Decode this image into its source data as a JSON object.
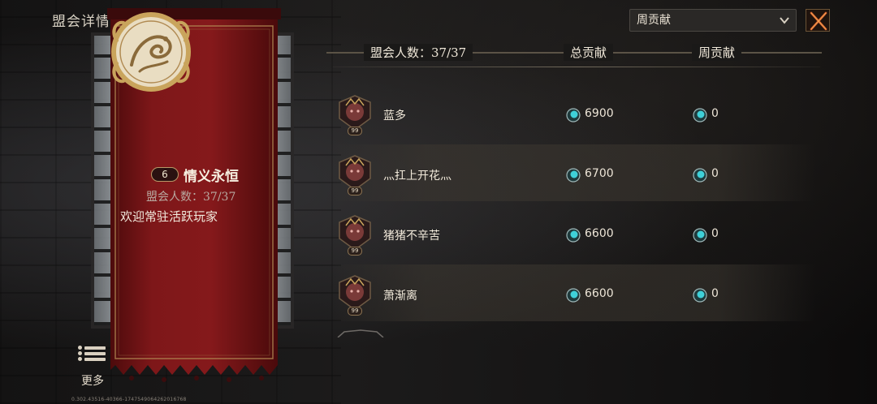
{
  "header": {
    "title": "盟会详情"
  },
  "guild": {
    "level": "6",
    "name": "情义永恒",
    "member_count": "盟会人数：37/37",
    "announcement": "欢迎常驻活跃玩家"
  },
  "more": {
    "label": "更多"
  },
  "version_text": "0.302.43516-40366-1747549064262016768",
  "filter": {
    "selected": "周贡献"
  },
  "table": {
    "col_members": "盟会人数：37/37",
    "col_total": "总贡献",
    "col_week": "周贡献",
    "rows": [
      {
        "name": "蓝多",
        "level": "99",
        "total": "6900",
        "week": "0"
      },
      {
        "name": "灬扛上开花灬",
        "level": "99",
        "total": "6700",
        "week": "0"
      },
      {
        "name": "猪猪不辛苦",
        "level": "99",
        "total": "6600",
        "week": "0"
      },
      {
        "name": "萧渐离",
        "level": "99",
        "total": "6600",
        "week": "0"
      }
    ]
  },
  "colors": {
    "banner": "#7a1416",
    "gold": "#c9a45c",
    "coin": "#3fd0d8"
  }
}
